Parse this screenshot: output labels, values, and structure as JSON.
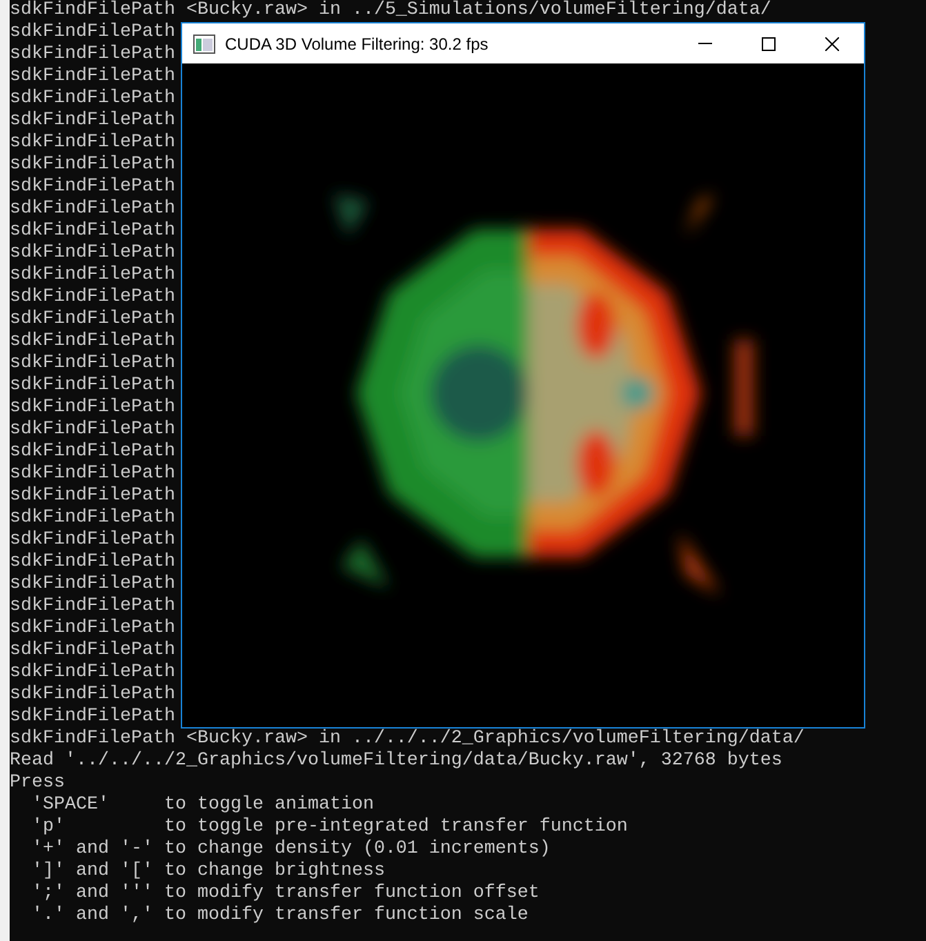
{
  "console": {
    "lines": [
      "sdkFindFilePath <Bucky.raw> in ../5_Simulations/volumeFiltering/data/",
      "sdkFindFilePath",
      "sdkFindFilePath",
      "sdkFindFilePath",
      "sdkFindFilePath",
      "sdkFindFilePath",
      "sdkFindFilePath",
      "sdkFindFilePath",
      "sdkFindFilePath",
      "sdkFindFilePath",
      "sdkFindFilePath",
      "sdkFindFilePath",
      "sdkFindFilePath",
      "sdkFindFilePath",
      "sdkFindFilePath",
      "sdkFindFilePath",
      "sdkFindFilePath",
      "sdkFindFilePath",
      "sdkFindFilePath",
      "sdkFindFilePath",
      "sdkFindFilePath",
      "sdkFindFilePath",
      "sdkFindFilePath",
      "sdkFindFilePath",
      "sdkFindFilePath",
      "sdkFindFilePath",
      "sdkFindFilePath",
      "sdkFindFilePath",
      "sdkFindFilePath",
      "sdkFindFilePath",
      "sdkFindFilePath",
      "sdkFindFilePath",
      "sdkFindFilePath",
      "sdkFindFilePath <Bucky.raw> in ../../../2_Graphics/volumeFiltering/data/",
      "Read '../../../2_Graphics/volumeFiltering/data/Bucky.raw', 32768 bytes",
      "Press",
      "  'SPACE'     to toggle animation",
      "  'p'         to toggle pre-integrated transfer function",
      "  '+' and '-' to change density (0.01 increments)",
      "  ']' and '[' to change brightness",
      "  ';' and ''' to modify transfer function offset",
      "  '.' and ',' to modify transfer function scale"
    ]
  },
  "window": {
    "title": "CUDA 3D Volume Filtering: 30.2 fps"
  }
}
